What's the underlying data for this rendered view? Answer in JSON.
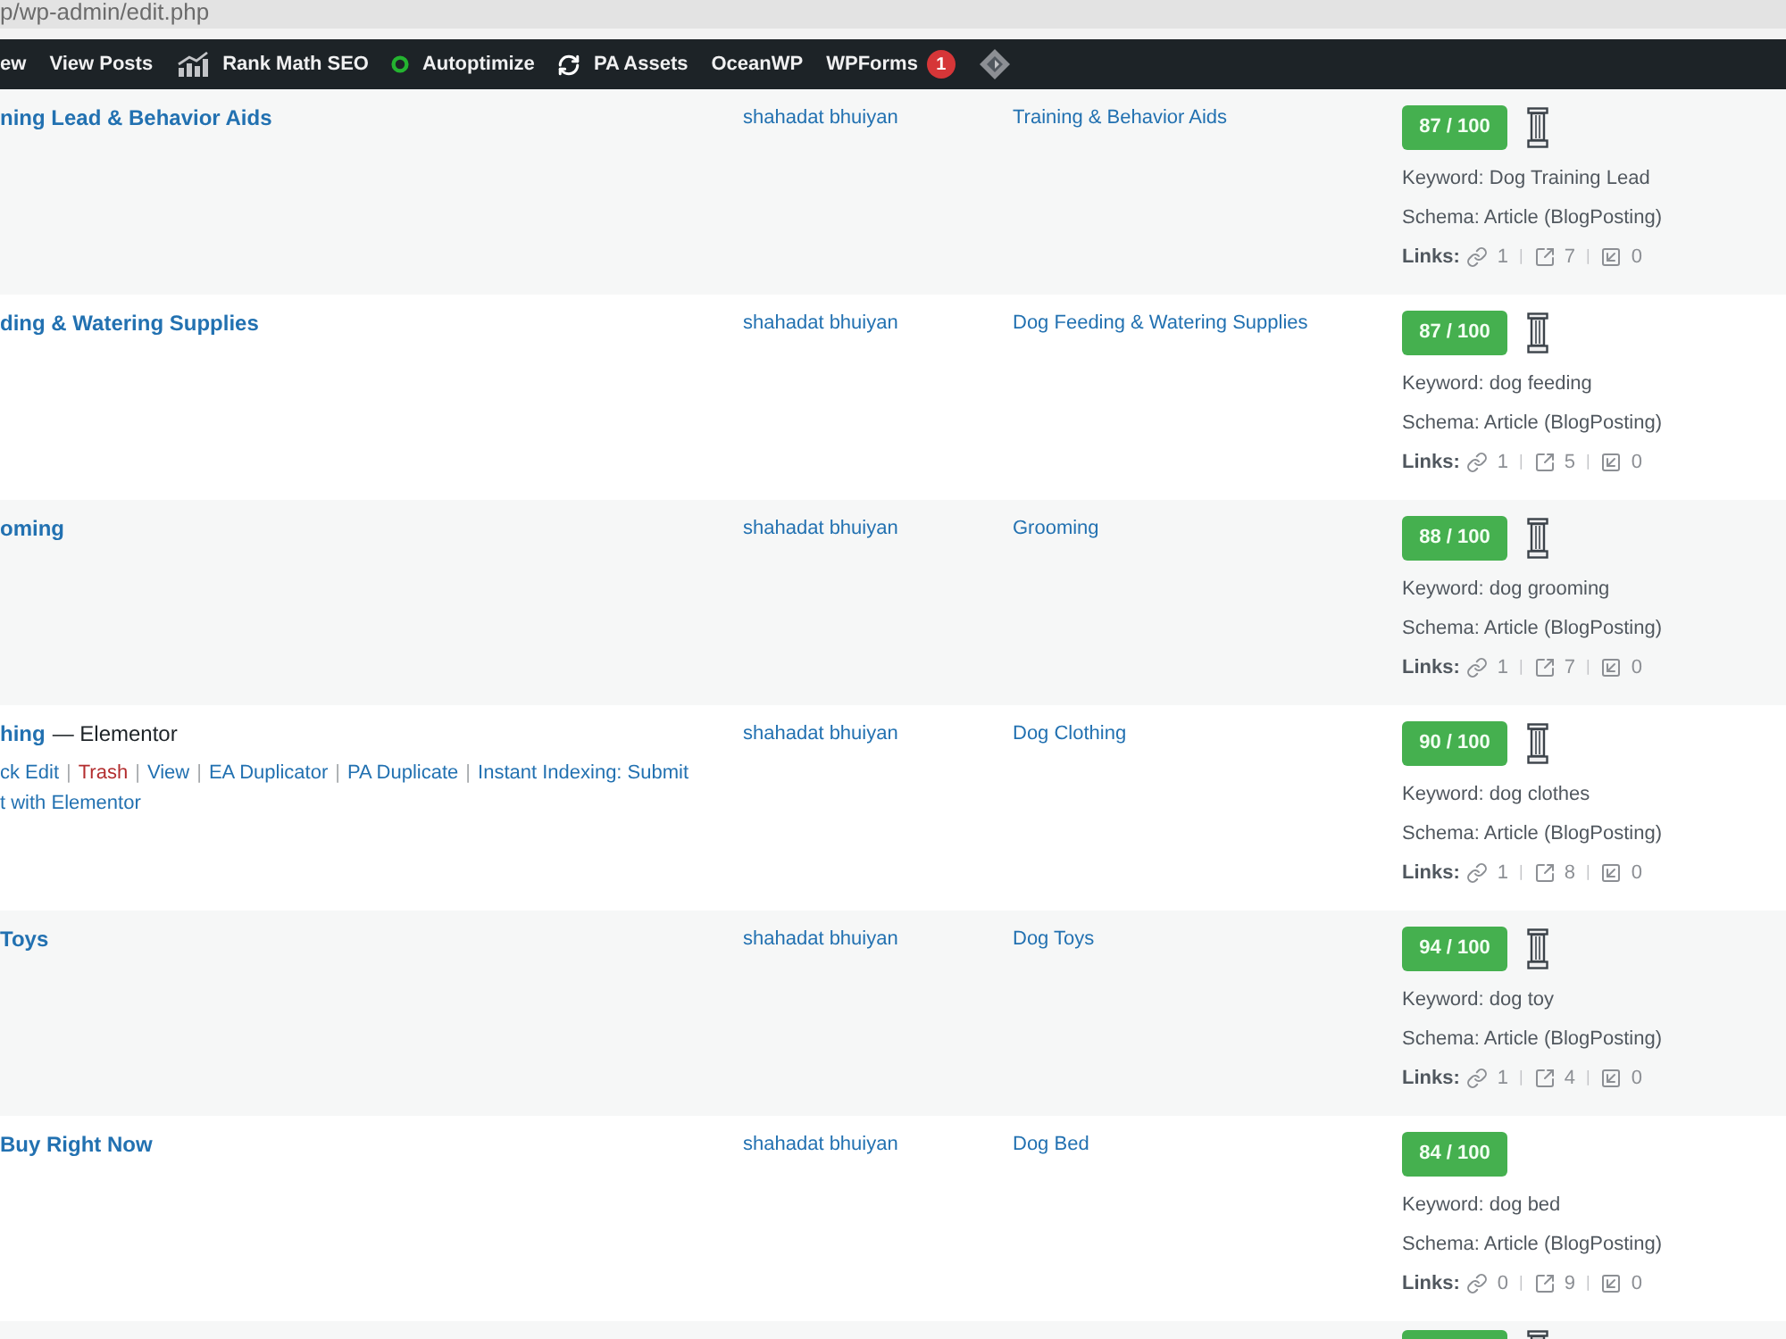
{
  "browser": {
    "address": "p/wp-admin/edit.php"
  },
  "admin_bar": {
    "items": [
      {
        "kind": "plain",
        "label": "ew"
      },
      {
        "kind": "plain",
        "label": "View Posts"
      },
      {
        "kind": "chart",
        "label": "Rank Math SEO"
      },
      {
        "kind": "status",
        "label": "Autoptimize"
      },
      {
        "kind": "sync",
        "label": "PA Assets"
      },
      {
        "kind": "plain",
        "label": "OceanWP"
      },
      {
        "kind": "plain",
        "label": "WPForms",
        "badge": "1"
      }
    ]
  },
  "posts": {
    "action_separator": "|",
    "link_separator": "|",
    "rows": [
      {
        "title": "ning Lead & Behavior Aids",
        "author": "shahadat bhuiyan",
        "category": "Training & Behavior Aids",
        "seo": {
          "score": "87 / 100",
          "pillar": true,
          "keyword": "Keyword: Dog Training Lead",
          "schema": "Schema: Article (BlogPosting)",
          "links": {
            "label": "Links:",
            "internal": "1",
            "external": "7",
            "incoming": "0"
          }
        }
      },
      {
        "title": "ding & Watering Supplies",
        "author": "shahadat bhuiyan",
        "category": "Dog Feeding & Watering Supplies",
        "seo": {
          "score": "87 / 100",
          "pillar": true,
          "keyword": "Keyword: dog feeding",
          "schema": "Schema: Article (BlogPosting)",
          "links": {
            "label": "Links:",
            "internal": "1",
            "external": "5",
            "incoming": "0"
          }
        }
      },
      {
        "title": "oming",
        "author": "shahadat bhuiyan",
        "category": "Grooming",
        "seo": {
          "score": "88 / 100",
          "pillar": true,
          "keyword": "Keyword: dog grooming",
          "schema": "Schema: Article (BlogPosting)",
          "links": {
            "label": "Links:",
            "internal": "1",
            "external": "7",
            "incoming": "0"
          }
        }
      },
      {
        "title": "hing",
        "state": "— Elementor",
        "row_actions": [
          [
            {
              "kind": "link",
              "label": "ck Edit"
            },
            {
              "kind": "delete",
              "label": "Trash"
            },
            {
              "kind": "link",
              "label": "View"
            },
            {
              "kind": "link",
              "label": "EA Duplicator"
            },
            {
              "kind": "link",
              "label": "PA Duplicate"
            },
            {
              "kind": "link",
              "label": "Instant Indexing: Submit"
            }
          ],
          [
            {
              "kind": "link",
              "label": "t with Elementor"
            }
          ]
        ],
        "author": "shahadat bhuiyan",
        "category": "Dog Clothing",
        "seo": {
          "score": "90 / 100",
          "pillar": true,
          "keyword": "Keyword: dog clothes",
          "schema": "Schema: Article (BlogPosting)",
          "links": {
            "label": "Links:",
            "internal": "1",
            "external": "8",
            "incoming": "0"
          }
        }
      },
      {
        "title": "Toys",
        "author": "shahadat bhuiyan",
        "category": "Dog Toys",
        "seo": {
          "score": "94 / 100",
          "pillar": true,
          "keyword": "Keyword: dog toy",
          "schema": "Schema: Article (BlogPosting)",
          "links": {
            "label": "Links:",
            "internal": "1",
            "external": "4",
            "incoming": "0"
          }
        }
      },
      {
        "title": "Buy Right Now",
        "author": "shahadat bhuiyan",
        "category": "Dog Bed",
        "seo": {
          "score": "84 / 100",
          "pillar": false,
          "keyword": "Keyword: dog bed",
          "schema": "Schema: Article (BlogPosting)",
          "links": {
            "label": "Links:",
            "internal": "0",
            "external": "9",
            "incoming": "0"
          }
        }
      }
    ],
    "partial_row": {
      "pillar": true
    }
  }
}
